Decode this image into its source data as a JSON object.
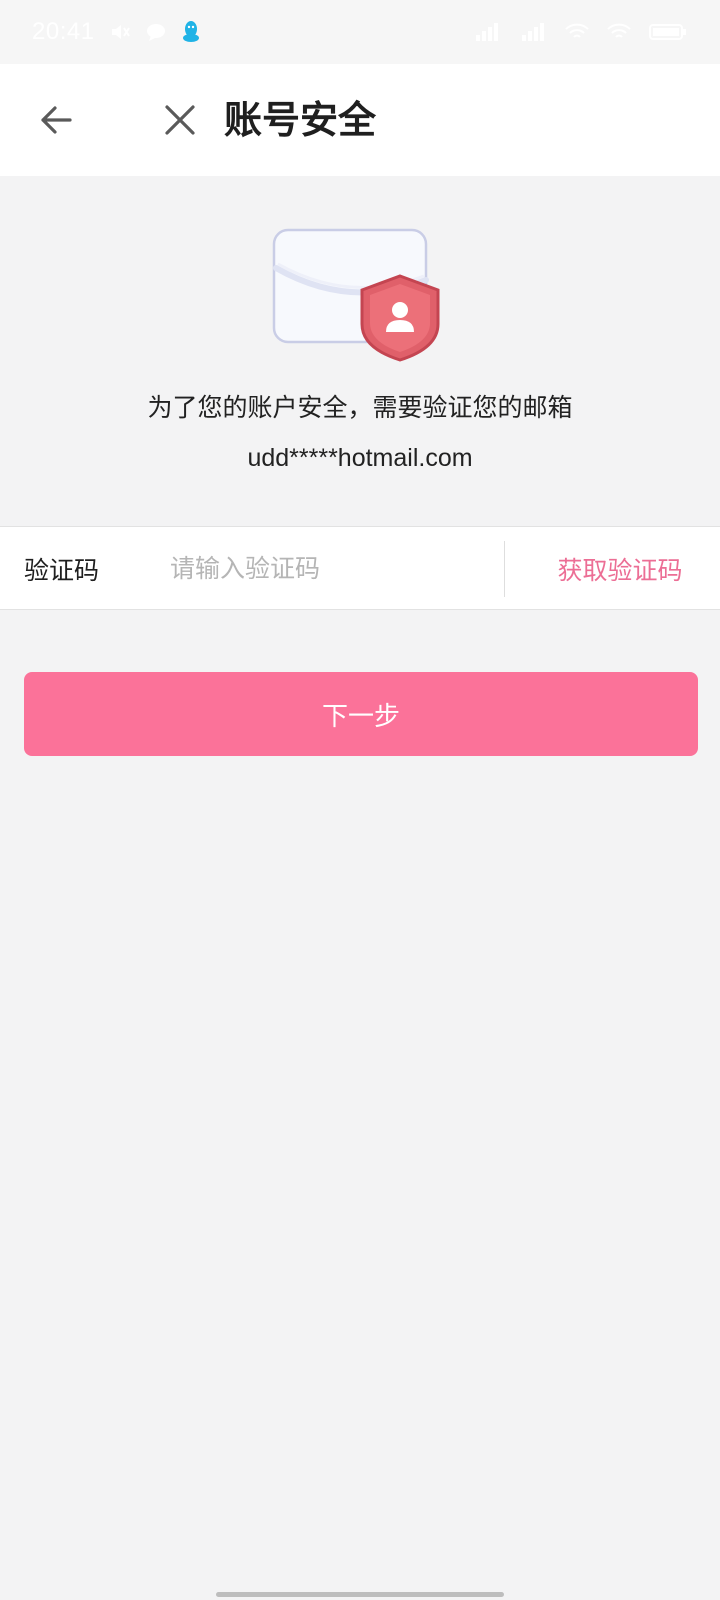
{
  "status_bar": {
    "time": "20:41",
    "left_icons": [
      "mute-icon",
      "chat-bubble-icon",
      "qq-penguin-icon"
    ],
    "right_icons": [
      "signal-5g-icon",
      "signal-4g-icon",
      "wifi-icon",
      "wifi-icon",
      "battery-icon"
    ]
  },
  "header": {
    "title": "账号安全",
    "back_icon": "arrow-left-icon",
    "close_icon": "close-icon"
  },
  "hero": {
    "illustration_icon": "envelope-shield-icon",
    "message": "为了您的账户安全，需要验证您的邮箱",
    "email": "udd*****hotmail.com"
  },
  "code_row": {
    "label": "验证码",
    "placeholder": "请输入验证码",
    "value": "",
    "get_code_label": "获取验证码"
  },
  "next_button": {
    "label": "下一步"
  },
  "colors": {
    "accent": "#fb7299",
    "link": "#ec6e95",
    "background": "#f3f3f4",
    "shield": "#e0606a"
  }
}
